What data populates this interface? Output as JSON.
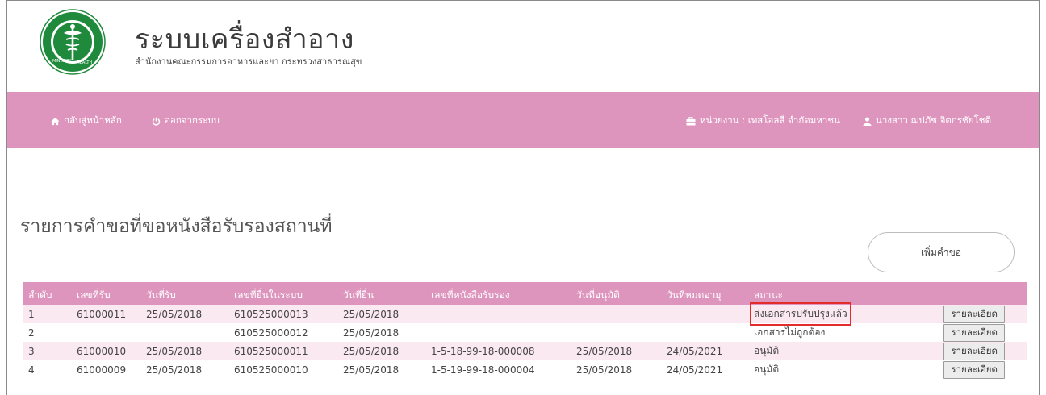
{
  "header": {
    "title": "ระบบเครื่องสำอาง",
    "subtitle": "สำนักงานคณะกรรมการอาหารและยา กระทรวงสาธารณสุข",
    "logo_icon": "ministry-of-public-health-seal"
  },
  "nav": {
    "home": {
      "label": "กลับสู่หน้าหลัก",
      "icon": "home-icon"
    },
    "logout": {
      "label": "ออกจากระบบ",
      "icon": "power-icon"
    },
    "agency": {
      "label": "หน่วยงาน : เทสโอลลี่ จำกัดมหาชน",
      "icon": "briefcase-icon"
    },
    "user": {
      "label": "นางสาว ฌปภัช จิตกรชัยโชติ",
      "icon": "user-icon"
    }
  },
  "page": {
    "heading": "รายการคำขอที่ขอหนังสือรับรองสถานที่",
    "add_button": "เพิ่มคำขอ"
  },
  "table": {
    "columns": [
      "ลำดับ",
      "เลขที่รับ",
      "วันที่รับ",
      "เลขที่ยื่นในระบบ",
      "วันที่ยื่น",
      "เลขที่หนังสือรับรอง",
      "วันที่อนุมัติ",
      "วันที่หมดอายุ",
      "สถานะ",
      ""
    ],
    "detail_label": "รายละเอียด",
    "rows": [
      {
        "no": "1",
        "receive_no": "61000011",
        "receive_date": "25/05/2018",
        "submit_no": "610525000013",
        "submit_date": "25/05/2018",
        "cert_no": "",
        "approve_date": "",
        "expire_date": "",
        "status": "ส่งเอกสารปรับปรุงแล้ว",
        "highlighted": true
      },
      {
        "no": "2",
        "receive_no": "",
        "receive_date": "",
        "submit_no": "610525000012",
        "submit_date": "25/05/2018",
        "cert_no": "",
        "approve_date": "",
        "expire_date": "",
        "status": "เอกสารไม่ถูกต้อง",
        "highlighted": false
      },
      {
        "no": "3",
        "receive_no": "61000010",
        "receive_date": "25/05/2018",
        "submit_no": "610525000011",
        "submit_date": "25/05/2018",
        "cert_no": "1-5-18-99-18-000008",
        "approve_date": "25/05/2018",
        "expire_date": "24/05/2021",
        "status": "อนุมัติ",
        "highlighted": false
      },
      {
        "no": "4",
        "receive_no": "61000009",
        "receive_date": "25/05/2018",
        "submit_no": "610525000010",
        "submit_date": "25/05/2018",
        "cert_no": "1-5-19-99-18-000004",
        "approve_date": "25/05/2018",
        "expire_date": "24/05/2021",
        "status": "อนุมัติ",
        "highlighted": false
      }
    ]
  },
  "colors": {
    "accent": "#de95bd",
    "row_alt": "#fbe9f2",
    "highlight": "#e32b2b",
    "logo_green": "#1f8a3c"
  }
}
